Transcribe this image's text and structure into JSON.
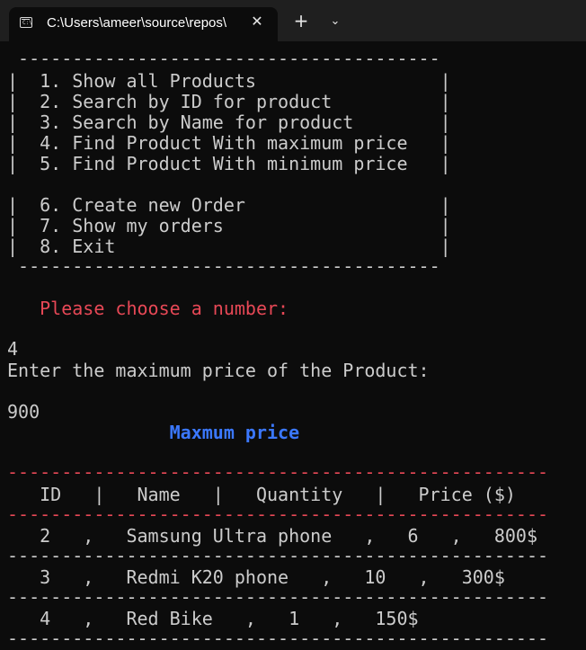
{
  "tab": {
    "title": "C:\\Users\\ameer\\source\\repos\\",
    "close_label": "✕",
    "icon": "terminal-icon",
    "new_tab_label": "+",
    "dropdown_label": "⌄"
  },
  "console": {
    "menu_border_top": " ---------------------------------------",
    "menu_items": [
      "|  1. Show all Products                 |",
      "|  2. Search by ID for product          |",
      "|  3. Search by Name for product        |",
      "|  4. Find Product With maximum price   |",
      "|  5. Find Product With minimum price   |",
      "|  6. Create new Order                  |",
      "|  7. Show my orders                    |",
      "|  8. Exit                              |"
    ],
    "menu_border_bottom": " ---------------------------------------",
    "prompt": "   Please choose a number:",
    "input_choice": "4",
    "price_prompt": "Enter the maximum price of the Product:",
    "input_price": "900",
    "result_title": "               Maxmum price",
    "table_sep": "--------------------------------------------------",
    "table_header": "   ID   |   Name   |   Quantity   |   Price ($)",
    "rows": [
      "   2   ,   Samsung Ultra phone   ,   6   ,   800$",
      "   3   ,   Redmi K20 phone   ,   10   ,   300$",
      "   4   ,   Red Bike   ,   1   ,   150$"
    ]
  },
  "colors": {
    "background": "#0c0c0c",
    "text": "#cccccc",
    "prompt_red": "#e74856",
    "title_blue": "#3b78ff"
  }
}
